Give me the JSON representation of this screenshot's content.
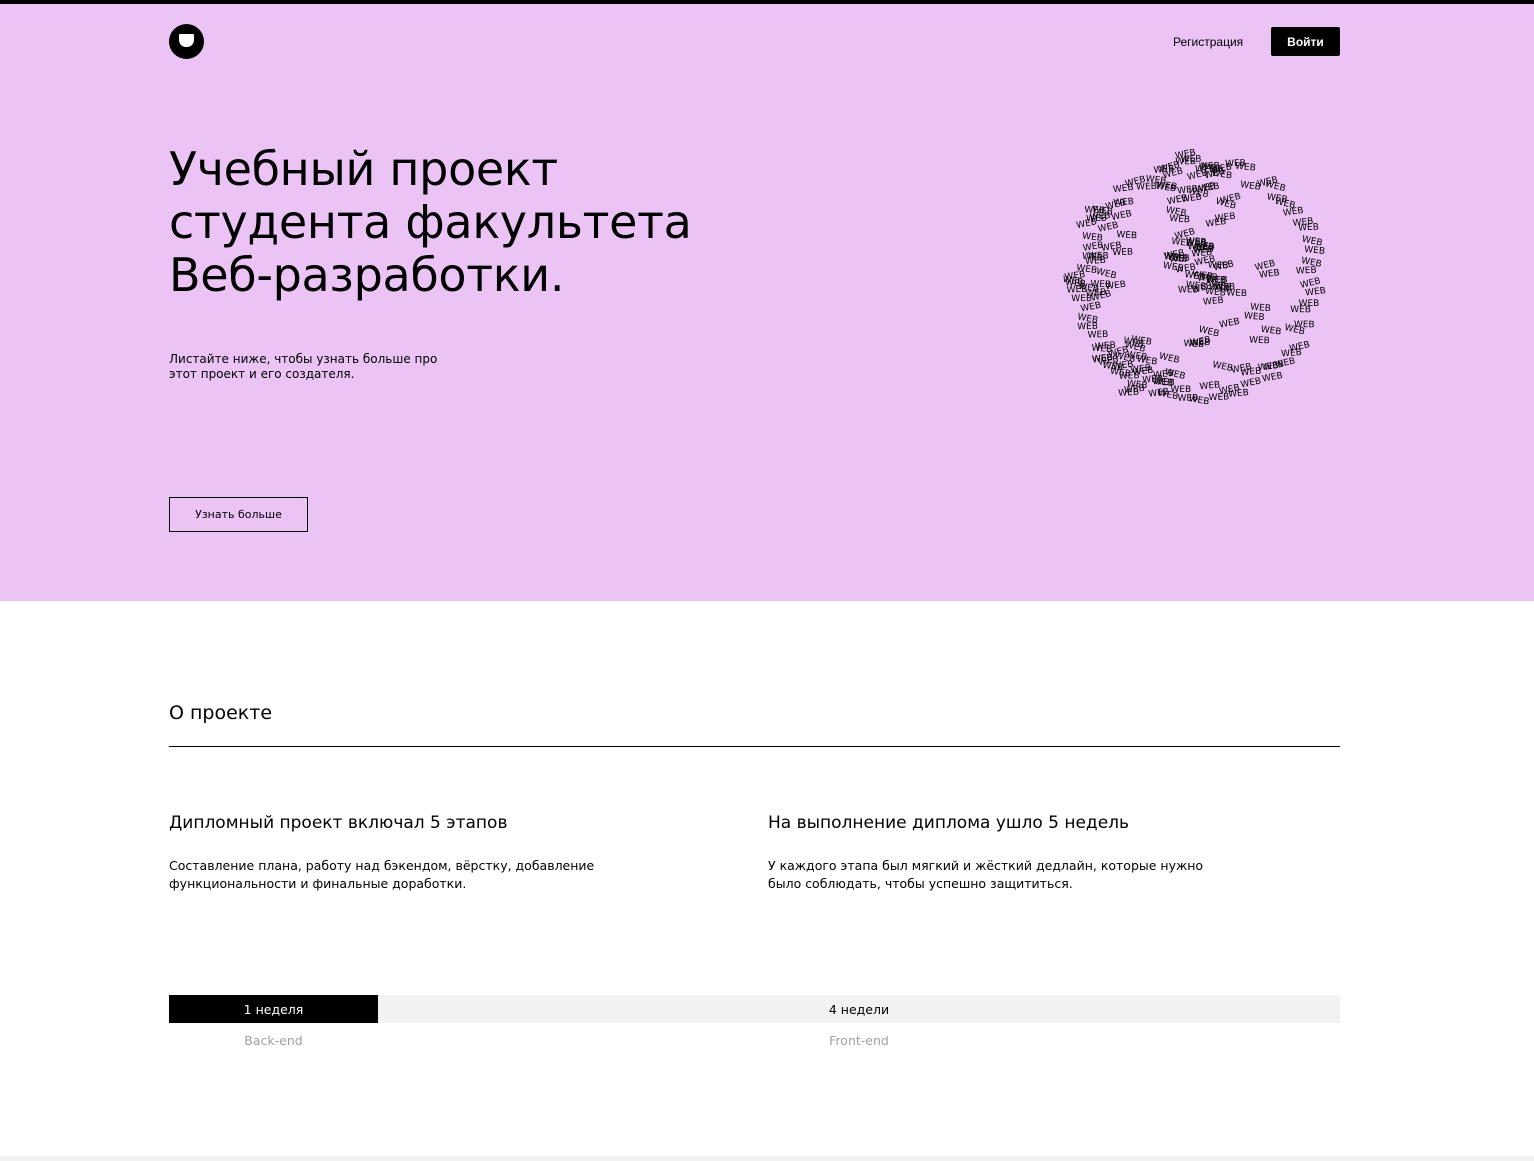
{
  "colors": {
    "hero_background": "#EBC4F5",
    "accent": "#000000",
    "timeline_track": "#F2F2F2",
    "timeline_caption": "#A0A0A0"
  },
  "header": {
    "logo_icon": "logo-icon",
    "register_label": "Регистрация",
    "login_label": "Войти"
  },
  "hero": {
    "title": "Учебный проект студента факультета Веб-разработки.",
    "subtitle": "Листайте ниже, чтобы узнать больше про этот проект и его создателя.",
    "button_label": "Узнать больше",
    "globe_word": "WEB",
    "globe_icon": "globe-icon"
  },
  "about": {
    "title": "О проекте",
    "columns": [
      {
        "heading": "Дипломный проект включал 5 этапов",
        "text": "Составление плана, работу над бэкендом, вёрстку, добавление функциональности и финальные доработки."
      },
      {
        "heading": "На выполнение диплома ушло 5 недель",
        "text": "У каждого этапа был мягкий и жёсткий дедлайн, которые нужно было соблюдать, чтобы успешно защититься."
      }
    ]
  },
  "timeline": {
    "backend_duration": "1 неделя",
    "frontend_duration": "4 недели",
    "backend_label": "Back-end",
    "frontend_label": "Front-end"
  }
}
